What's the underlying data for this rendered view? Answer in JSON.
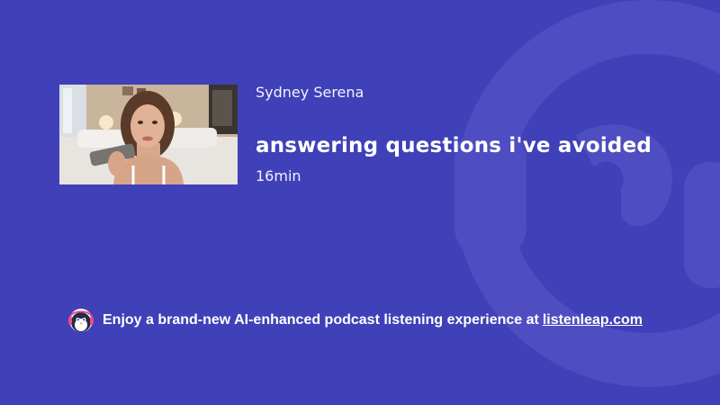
{
  "episode": {
    "author": "Sydney Serena",
    "title": "answering questions i've avoided",
    "duration": "16min"
  },
  "promo": {
    "text": "Enjoy a brand-new AI-enhanced podcast listening experience at",
    "link_text": "listenleap.com"
  },
  "icons": {
    "background": "headphones-logo-icon",
    "mascot": "penguin-mascot-icon"
  },
  "colors": {
    "background": "#4040b8",
    "logo_watermark": "#5050c0",
    "text": "#ffffff"
  }
}
